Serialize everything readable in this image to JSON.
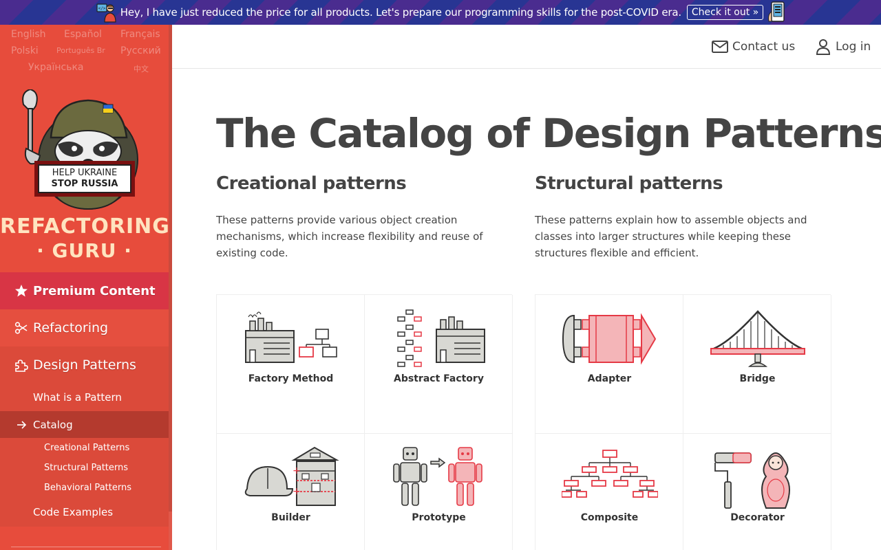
{
  "banner": {
    "text": "Hey, I have just reduced the price for all products. Let's prepare our programming skills for the post-COVID era.",
    "button": "Check it out »"
  },
  "sidebar": {
    "languages": [
      "English",
      "Español",
      "Français",
      "Polski",
      "Português Br",
      "Русский",
      "Українська",
      "中文"
    ],
    "help_badge": {
      "line1": "HELP UKRAINE",
      "line2": "STOP RUSSIA"
    },
    "brand": {
      "line1": "REFACTORING",
      "line2": "· GURU ·"
    },
    "nav": {
      "premium": "Premium Content",
      "refactoring": "Refactoring",
      "design_patterns": "Design Patterns",
      "what_is_pattern": "What is a Pattern",
      "catalog": "Catalog",
      "creational": "Creational Patterns",
      "structural": "Structural Patterns",
      "behavioral": "Behavioral Patterns",
      "code_examples": "Code Examples"
    }
  },
  "header": {
    "contact": "Contact us",
    "login": "Log in"
  },
  "main": {
    "title": "The Catalog of Design Patterns",
    "creational": {
      "title": "Creational patterns",
      "description": "These patterns provide various object creation mechanisms, which increase flexibility and reuse of existing code.",
      "patterns": [
        "Factory Method",
        "Abstract Factory",
        "Builder",
        "Prototype"
      ]
    },
    "structural": {
      "title": "Structural patterns",
      "description": "These patterns explain how to assemble objects and classes into larger structures while keeping these structures flexible and efficient.",
      "patterns": [
        "Adapter",
        "Bridge",
        "Composite",
        "Decorator"
      ]
    }
  },
  "colors": {
    "sidebar": "#e74c3c",
    "banner_primary": "#4a2c8f",
    "banner_secondary": "#283593",
    "text": "#444444",
    "accent_red": "#e53945"
  }
}
